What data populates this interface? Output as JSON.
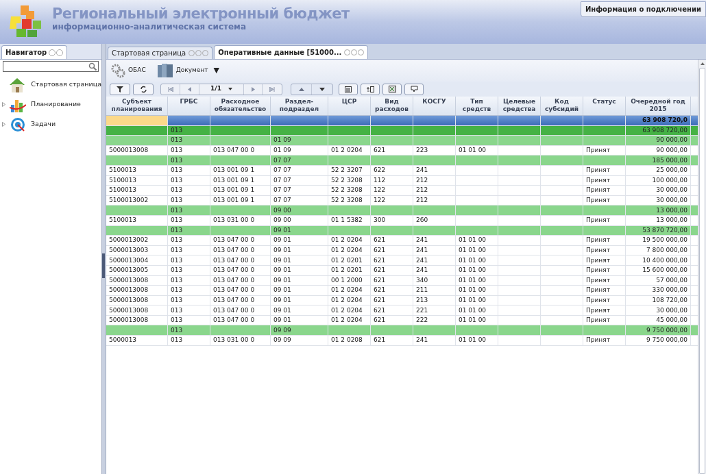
{
  "app": {
    "title": "Региональный электронный бюджет",
    "subtitle": "информационно-аналитическая система",
    "connection_info": "Информация о подключении"
  },
  "navigator": {
    "tab": "Навигатор",
    "items": [
      {
        "label": "Стартовая страница",
        "kind": "home",
        "expandable": false
      },
      {
        "label": "Планирование",
        "kind": "chart",
        "expandable": true
      },
      {
        "label": "Задачи",
        "kind": "target",
        "expandable": true
      }
    ]
  },
  "tabs": [
    {
      "label": "Стартовая страница",
      "selected": false
    },
    {
      "label": "Оперативные данные [51000...",
      "selected": true
    }
  ],
  "toolbar": {
    "obas": "ОБАС",
    "document": "Документ",
    "document_caret": "▼"
  },
  "pager": {
    "page": "1/1"
  },
  "columns": [
    "Субъект планирования",
    "ГРБС",
    "Расходное обязательство",
    "Раздел-подраздел",
    "ЦСР",
    "Вид расходов",
    "КОСГУ",
    "Тип средств",
    "Целевые средства",
    "Код субсидий",
    "Статус",
    "Очередной год 2015"
  ],
  "rows": [
    {
      "kind": "total",
      "amount": "63 908 720,0"
    },
    {
      "kind": "group",
      "grbs": "013",
      "amount": "63 908 720,00"
    },
    {
      "kind": "subgroup",
      "grbs": "013",
      "section": "01 09",
      "amount": "90 000,00"
    },
    {
      "kind": "data",
      "subject": "5000013008",
      "grbs": "013",
      "obligation": "013 047 00 0",
      "section": "01 09",
      "csr": "01 2 0204",
      "vr": "621",
      "kosgu": "223",
      "fund_type": "01 01 00",
      "status": "Принят",
      "amount": "90 000,00"
    },
    {
      "kind": "subgroup",
      "grbs": "013",
      "section": "07 07",
      "amount": "185 000,00"
    },
    {
      "kind": "data",
      "subject": "5100013",
      "grbs": "013",
      "obligation": "013 001 09 1",
      "section": "07 07",
      "csr": "52 2 3207",
      "vr": "622",
      "kosgu": "241",
      "status": "Принят",
      "amount": "25 000,00"
    },
    {
      "kind": "data",
      "subject": "5100013",
      "grbs": "013",
      "obligation": "013 001 09 1",
      "section": "07 07",
      "csr": "52 2 3208",
      "vr": "112",
      "kosgu": "212",
      "status": "Принят",
      "amount": "100 000,00"
    },
    {
      "kind": "data",
      "subject": "5100013",
      "grbs": "013",
      "obligation": "013 001 09 1",
      "section": "07 07",
      "csr": "52 2 3208",
      "vr": "122",
      "kosgu": "212",
      "status": "Принят",
      "amount": "30 000,00"
    },
    {
      "kind": "data",
      "subject": "5100013002",
      "grbs": "013",
      "obligation": "013 001 09 1",
      "section": "07 07",
      "csr": "52 2 3208",
      "vr": "122",
      "kosgu": "212",
      "status": "Принят",
      "amount": "30 000,00"
    },
    {
      "kind": "subgroup",
      "grbs": "013",
      "section": "09 00",
      "amount": "13 000,00"
    },
    {
      "kind": "data",
      "subject": "5100013",
      "grbs": "013",
      "obligation": "013 031 00 0",
      "section": "09 00",
      "csr": "01 1 5382",
      "vr": "300",
      "kosgu": "260",
      "status": "Принят",
      "amount": "13 000,00"
    },
    {
      "kind": "subgroup",
      "grbs": "013",
      "section": "09 01",
      "amount": "53 870 720,00"
    },
    {
      "kind": "data",
      "subject": "5000013002",
      "grbs": "013",
      "obligation": "013 047 00 0",
      "section": "09 01",
      "csr": "01 2 0204",
      "vr": "621",
      "kosgu": "241",
      "fund_type": "01 01 00",
      "status": "Принят",
      "amount": "19 500 000,00"
    },
    {
      "kind": "data",
      "subject": "5000013003",
      "grbs": "013",
      "obligation": "013 047 00 0",
      "section": "09 01",
      "csr": "01 2 0204",
      "vr": "621",
      "kosgu": "241",
      "fund_type": "01 01 00",
      "status": "Принят",
      "amount": "7 800 000,00"
    },
    {
      "kind": "data",
      "subject": "5000013004",
      "grbs": "013",
      "obligation": "013 047 00 0",
      "section": "09 01",
      "csr": "01 2 0201",
      "vr": "621",
      "kosgu": "241",
      "fund_type": "01 01 00",
      "status": "Принят",
      "amount": "10 400 000,00"
    },
    {
      "kind": "data",
      "subject": "5000013005",
      "grbs": "013",
      "obligation": "013 047 00 0",
      "section": "09 01",
      "csr": "01 2 0201",
      "vr": "621",
      "kosgu": "241",
      "fund_type": "01 01 00",
      "status": "Принят",
      "amount": "15 600 000,00"
    },
    {
      "kind": "data",
      "subject": "5000013008",
      "grbs": "013",
      "obligation": "013 047 00 0",
      "section": "09 01",
      "csr": "00 1 2000",
      "vr": "621",
      "kosgu": "340",
      "fund_type": "01 01 00",
      "status": "Принят",
      "amount": "57 000,00"
    },
    {
      "kind": "data",
      "subject": "5000013008",
      "grbs": "013",
      "obligation": "013 047 00 0",
      "section": "09 01",
      "csr": "01 2 0204",
      "vr": "621",
      "kosgu": "211",
      "fund_type": "01 01 00",
      "status": "Принят",
      "amount": "330 000,00"
    },
    {
      "kind": "data",
      "subject": "5000013008",
      "grbs": "013",
      "obligation": "013 047 00 0",
      "section": "09 01",
      "csr": "01 2 0204",
      "vr": "621",
      "kosgu": "213",
      "fund_type": "01 01 00",
      "status": "Принят",
      "amount": "108 720,00"
    },
    {
      "kind": "data",
      "subject": "5000013008",
      "grbs": "013",
      "obligation": "013 047 00 0",
      "section": "09 01",
      "csr": "01 2 0204",
      "vr": "621",
      "kosgu": "221",
      "fund_type": "01 01 00",
      "status": "Принят",
      "amount": "30 000,00"
    },
    {
      "kind": "data",
      "subject": "5000013008",
      "grbs": "013",
      "obligation": "013 047 00 0",
      "section": "09 01",
      "csr": "01 2 0204",
      "vr": "621",
      "kosgu": "222",
      "fund_type": "01 01 00",
      "status": "Принят",
      "amount": "45 000,00"
    },
    {
      "kind": "subgroup",
      "grbs": "013",
      "section": "09 09",
      "amount": "9 750 000,00"
    },
    {
      "kind": "data",
      "subject": "5000013",
      "grbs": "013",
      "obligation": "013 031 00 0",
      "section": "09 09",
      "csr": "01 2 0208",
      "vr": "621",
      "kosgu": "241",
      "fund_type": "01 01 00",
      "status": "Принят",
      "amount": "9 750 000,00"
    }
  ]
}
